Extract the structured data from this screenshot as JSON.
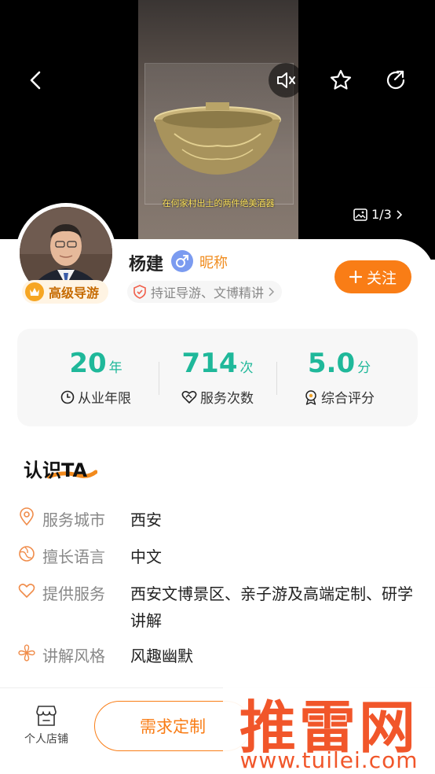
{
  "hero": {
    "caption": "在何家村出土的两件绝美酒器",
    "photo_counter": "1/3"
  },
  "profile": {
    "name": "杨建",
    "nickname": "昵称",
    "level_badge": "高级导游",
    "cert_tag": "持证导游、文博精讲",
    "follow_label": "关注"
  },
  "stats": [
    {
      "value": "20",
      "unit": "年",
      "label": "从业年限",
      "icon": "clock-icon"
    },
    {
      "value": "714",
      "unit": "次",
      "label": "服务次数",
      "icon": "handshake-heart-icon"
    },
    {
      "value": "5.0",
      "unit": "分",
      "label": "综合评分",
      "icon": "rosette-icon"
    }
  ],
  "about": {
    "title": "认识TA",
    "rows": [
      {
        "key": "服务城市",
        "value": "西安",
        "icon": "location-pin-icon"
      },
      {
        "key": "擅长语言",
        "value": "中文",
        "icon": "globe-icon"
      },
      {
        "key": "提供服务",
        "value": "西安文博景区、亲子游及高端定制、研学讲解",
        "icon": "heart-icon"
      },
      {
        "key": "讲解风格",
        "value": "风趣幽默",
        "icon": "flower-icon"
      }
    ]
  },
  "bottom": {
    "shop_label": "个人店铺",
    "demand_label": "需求定制"
  },
  "watermark": {
    "text": "推雷网",
    "url": "www.tuilei.com"
  },
  "colors": {
    "accent": "#f97d16",
    "stat_green": "#1fb89a",
    "gender_blue": "#7b9bf0",
    "watermark_red": "#f1562a"
  }
}
